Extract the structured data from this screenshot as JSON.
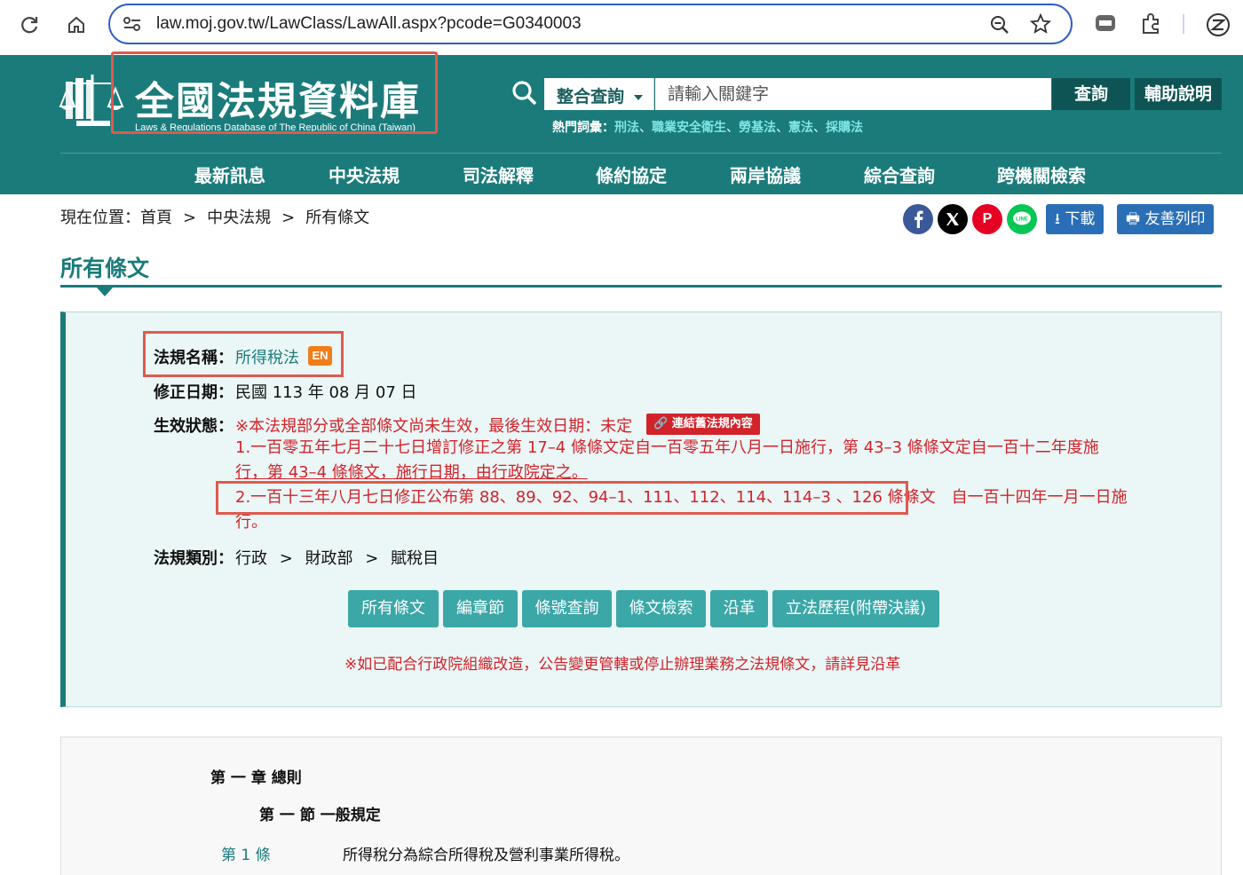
{
  "browser": {
    "url": "law.moj.gov.tw/LawClass/LawAll.aspx?pcode=G0340003"
  },
  "header": {
    "logo_title": "全國法規資料庫",
    "logo_subtitle": "Laws & Regulations Database of The Republic of China (Taiwan)",
    "search_scope": "整合查詢",
    "search_placeholder": "請輸入關鍵字",
    "query_button": "查詢",
    "help_button": "輔助說明",
    "hot_label": "熱門詞彙：",
    "hot_terms": [
      "刑法",
      "職業安全衛生",
      "勞基法",
      "憲法",
      "採購法"
    ],
    "hot_sep": "、",
    "nav": [
      "最新訊息",
      "中央法規",
      "司法解釋",
      "條約協定",
      "兩岸協議",
      "綜合查詢",
      "跨機關檢索"
    ]
  },
  "breadcrumb": {
    "prefix": "現在位置：",
    "items": [
      "首頁",
      "中央法規",
      "所有條文"
    ],
    "sep": ">"
  },
  "toolbar": {
    "download": "下載",
    "print": "友善列印"
  },
  "page_title": "所有條文",
  "law": {
    "name_label": "法規名稱：",
    "name": "所得稅法",
    "en_badge": "EN",
    "amend_label": "修正日期：",
    "amend_date": "民國 113 年 08 月 07 日",
    "status_label": "生效狀態：",
    "status_text": "※本法規部分或全部條文尚未生效，最後生效日期：未定",
    "old_link": "連結舊法規內容",
    "note1_line1": "1.一百零五年七月二十七日增訂修正之第 17–4 條條文定自一百零五年八月一日施行，第 43–3 條條文定自一百十二年度施",
    "note1_line2": "行，第 43–4 條條文，施行日期，由行政院定之。",
    "note2_line1_a": "2.一百十三年八月七日修正公布第 88、89、92、94–1、111、112、114、114–3 、126 條條文",
    "note2_line1_b": "自一百十四年一月一日施",
    "note2_line2": "行。",
    "category_label": "法規類別：",
    "category": [
      "行政",
      "財政部",
      "賦稅目"
    ],
    "category_sep": ">"
  },
  "actions": [
    "所有條文",
    "編章節",
    "條號查詢",
    "條文檢索",
    "沿革",
    "立法歷程(附帶決議)"
  ],
  "reorg_note": "※如已配合行政院組織改造，公告變更管轄或停止辦理業務之法規條文，請詳見沿革",
  "articles": {
    "chapter": "第 一 章 總則",
    "section": "第 一 節 一般規定",
    "article_no": "第 1 條",
    "article_text": "所得稅分為綜合所得稅及營利事業所得稅。"
  },
  "colors": {
    "teal": "#1b7b7b",
    "dark_teal": "#0e5454",
    "red": "#d2232a",
    "annotation_red": "#e05a4e"
  }
}
